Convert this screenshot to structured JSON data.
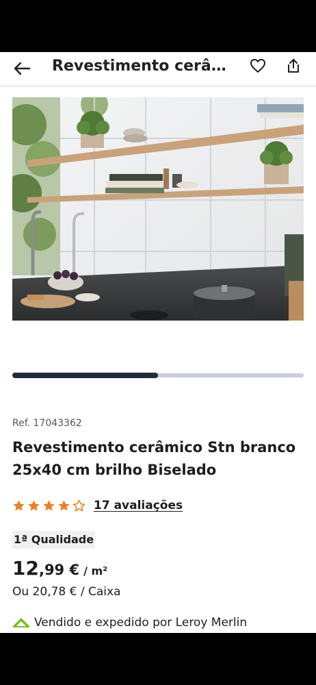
{
  "header": {
    "title": "Revestimento cerâmico Stn branco 25x40 cm brilho Biselado",
    "back_icon": "arrow-left-icon",
    "favorite_icon": "heart-icon",
    "share_icon": "share-icon"
  },
  "gallery": {
    "image_description_icon": "kitchen-shelves-photo",
    "carousel_progress": 0.5
  },
  "product": {
    "ref": "Ref. 17043362",
    "title": "Revestimento cerâmico Stn branco 25x40 cm brilho Biselado",
    "rating": 4,
    "rating_max": 5,
    "reviews_label": "17 avaliações",
    "quality_badge": "1ª Qualidade",
    "price_integer": "12",
    "price_decimal": ",99 €",
    "price_unit": "/ m²",
    "box_price": "Ou  20,78 € / Caixa",
    "seller": "Vendido e expedido por Leroy Merlin"
  },
  "colors": {
    "accent_star": "#ef7d1a",
    "carousel_active": "#232a3e",
    "carousel_track": "#c9ccd9",
    "brand_green": "#78be20"
  }
}
